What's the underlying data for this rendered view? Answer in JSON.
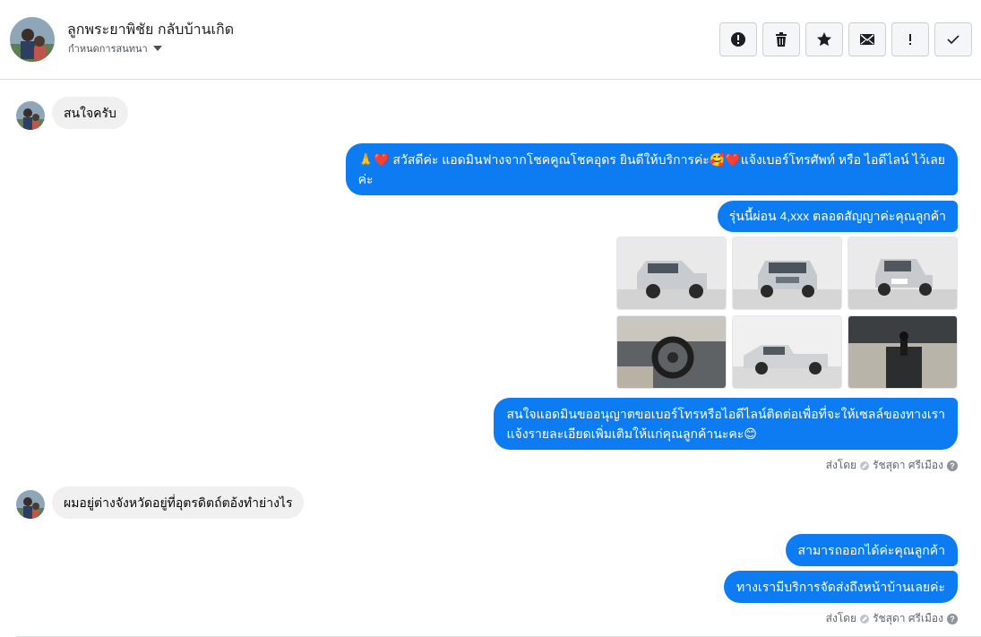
{
  "header": {
    "contact_name": "ลูกพระยาพิชัย กลับบ้านเกิด",
    "subtitle": "กำหนดการสนทนา",
    "actions": [
      {
        "icon": "alert-circle-icon",
        "label": "report"
      },
      {
        "icon": "trash-icon",
        "label": "delete"
      },
      {
        "icon": "star-icon",
        "label": "star"
      },
      {
        "icon": "envelope-icon",
        "label": "mark-unread"
      },
      {
        "icon": "exclamation-icon",
        "label": "follow-up"
      },
      {
        "icon": "check-icon",
        "label": "done"
      }
    ]
  },
  "messages": {
    "in_1": "สนใจครับ",
    "out_1_line1": "🙏❤️ สวัสดีค่ะ แอดมินฟางจากโชคคูณโชคอุดร ยินดีให้บริการค่ะ🥰❤️แจ้งเบอร์โทรศัพท์ หรือ ไอดีไลน์  ไว้เลย",
    "out_1_line2": "ค่ะ",
    "out_2": "รุ่นนี้ผ่อน 4,xxx ตลอดสัญญาค่ะคุณลูกค้า",
    "photos": [
      "car-front-left",
      "car-front",
      "car-rear",
      "car-interior-dashboard",
      "car-side",
      "car-interior-gear"
    ],
    "out_3_line1": "สนใจแอดมินขออนุญาตขอเบอร์โทรหรือไอดีไลน์ติดต่อเพื่อที่จะให้เซลล์ของทางเรา",
    "out_3_line2": "แจ้งรายละเอียดเพิ่มเติมให้แก่คุณลูกค้านะคะ😊",
    "sent_by_1": {
      "prefix": "ส่งโดย",
      "name": "รัชสุดา ศรีเมือง"
    },
    "in_2": "ผมอยู่ต่างจังหวัดอยู่ที่อุตรดิตถ์ตอ้งทำย่างไร",
    "out_4": "สามารถออกได้ค่ะคุณลูกค้า",
    "out_5": "ทางเรามีบริการจัดส่งถึงหน้าบ้านเลยค่ะ",
    "sent_by_2": {
      "prefix": "ส่งโดย",
      "name": "รัชสุดา ศรีเมือง"
    }
  },
  "colors": {
    "outgoing_bubble": "#0d7bf2",
    "incoming_bubble": "#f0f0f0"
  }
}
